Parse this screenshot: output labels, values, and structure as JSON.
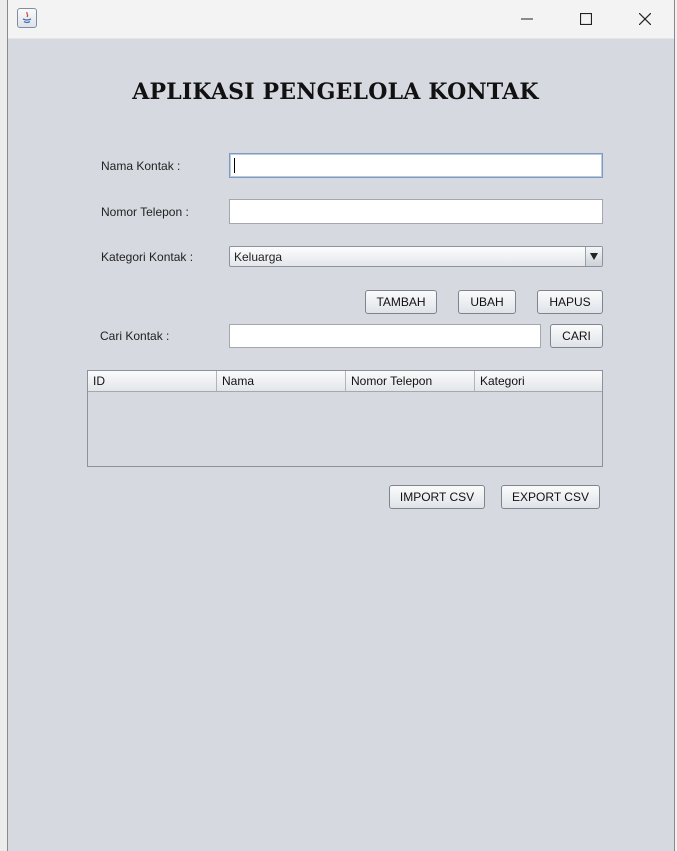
{
  "window": {
    "app_icon": "java-icon",
    "controls": [
      "minimize-icon",
      "maximize-icon",
      "close-icon"
    ]
  },
  "app": {
    "title": "APLIKASI PENGELOLA KONTAK"
  },
  "form": {
    "name_label": "Nama Kontak :",
    "name_value": "",
    "phone_label": "Nomor Telepon :",
    "phone_value": "",
    "category_label": "Kategori Kontak :",
    "category_selected": "Keluarga"
  },
  "actions": {
    "add_label": "TAMBAH",
    "edit_label": "UBAH",
    "delete_label": "HAPUS"
  },
  "search": {
    "label": "Cari Kontak :",
    "value": "",
    "button_label": "CARI"
  },
  "table": {
    "columns": [
      "ID",
      "Nama",
      "Nomor Telepon",
      "Kategori"
    ],
    "rows": []
  },
  "csv": {
    "import_label": "IMPORT CSV",
    "export_label": "EXPORT CSV"
  },
  "colors": {
    "window_bg": "#d6d9e0",
    "titlebar_bg": "#f3f3f3"
  }
}
